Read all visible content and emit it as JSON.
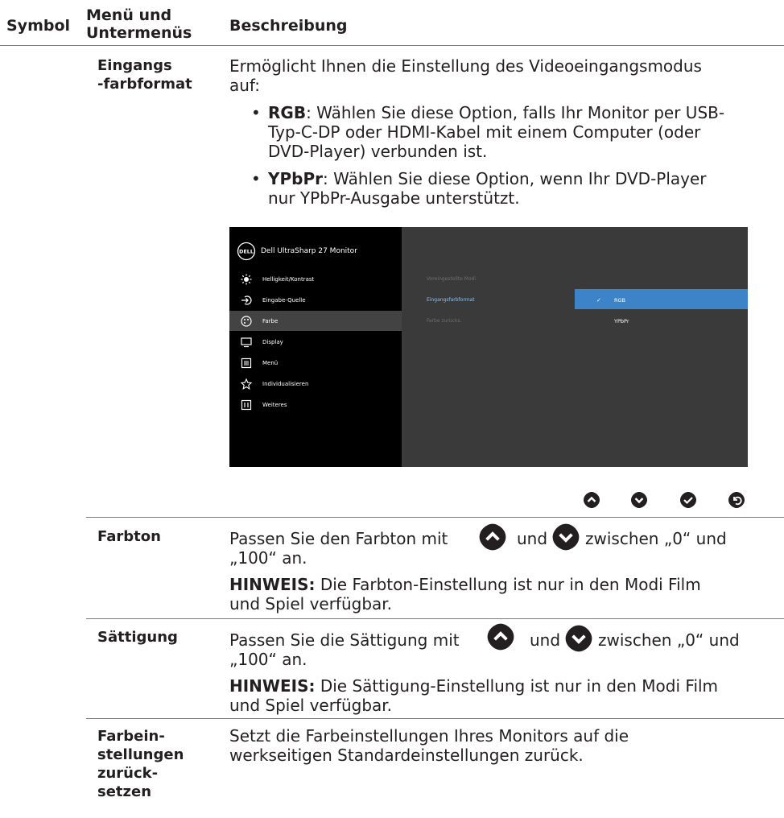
{
  "header": {
    "col_symbol": "Symbol",
    "col_menu_line1": "Menü und",
    "col_menu_line2": "Untermenüs",
    "col_desc": "Beschreibung"
  },
  "rows": {
    "eingang": {
      "label_line1": "Eingangs",
      "label_line2": "-farbformat",
      "desc_line1": "Ermöglicht Ihnen die Einstellung des Videoeingangsmodus",
      "desc_line2": "auf:",
      "bullets": [
        {
          "term": "RGB",
          "line1": ": Wählen Sie diese Option, falls Ihr Monitor per USB-",
          "line2": "Typ-C-DP oder HDMI-Kabel mit einem Computer (oder",
          "line3": "DVD-Player) verbunden ist."
        },
        {
          "term": "YPbPr",
          "line1": ": Wählen Sie diese Option, wenn Ihr DVD-Player",
          "line2": "nur YPbPr-Ausgabe unterstützt."
        }
      ]
    },
    "farbton": {
      "label": "Farbton",
      "line1_a": "Passen Sie den Farbton mit",
      "line1_b": "und",
      "line1_c": "zwischen „0“ und",
      "line2": "„100“ an.",
      "note_term": "HINWEIS:",
      "note_line1": " Die Farbton-Einstellung ist nur in den Modi Film",
      "note_line2": "und Spiel verfügbar."
    },
    "saettigung": {
      "label": "Sättigung",
      "line1_a": "Passen Sie die Sättigung mit",
      "line1_b": "und",
      "line1_c": "zwischen „0“ und",
      "line2": "„100“ an.",
      "note_term": "HINWEIS:",
      "note_line1": " Die Sättigung-Einstellung ist nur in den Modi Film",
      "note_line2": "und Spiel verfügbar."
    },
    "reset": {
      "label_line1": "Farbein-",
      "label_line2": "stellungen",
      "label_line3": "zurück-",
      "label_line4": "setzen",
      "desc_line1": "Setzt die Farbeinstellungen Ihres Monitors auf die",
      "desc_line2": "werkseitigen Standardeinstellungen zurück."
    }
  },
  "osd": {
    "logo": "DELL",
    "title": "Dell UltraSharp 27 Monitor",
    "menu": [
      {
        "label": "Helligkeit/Kontrast",
        "icon": "brightness-icon"
      },
      {
        "label": "Eingabe-Quelle",
        "icon": "input-source-icon"
      },
      {
        "label": "Farbe",
        "icon": "color-palette-icon"
      },
      {
        "label": "Display",
        "icon": "display-icon"
      },
      {
        "label": "Menü",
        "icon": "menu-list-icon"
      },
      {
        "label": "Individualisieren",
        "icon": "star-icon"
      },
      {
        "label": "Weiteres",
        "icon": "others-icon"
      }
    ],
    "submenu": [
      "Voreingestellte Modi",
      "Eingangsfarbformat",
      "Farbe zurücks."
    ],
    "options": [
      "RGB",
      "YPbPr"
    ],
    "selected_option": "RGB",
    "active_menu": "Farbe",
    "highlight_color": "#3c83c8",
    "nav_buttons": [
      "up-arrow-icon",
      "down-arrow-icon",
      "check-icon",
      "back-icon"
    ]
  }
}
